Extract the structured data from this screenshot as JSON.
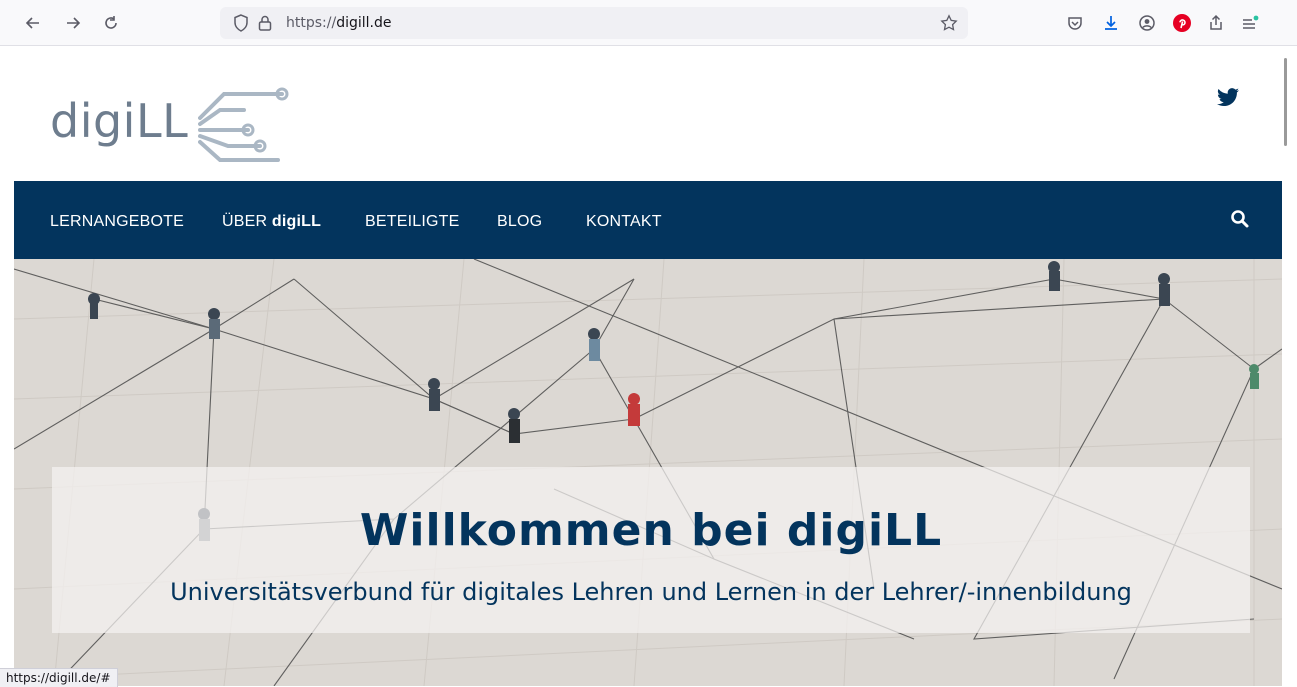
{
  "browser": {
    "url_scheme": "https://",
    "url_host": "digill.de",
    "status_url": "https://digill.de/#",
    "icons": [
      "back-icon",
      "forward-icon",
      "reload-icon",
      "shield-icon",
      "lock-icon",
      "star-icon",
      "pocket-icon",
      "download-icon",
      "account-icon",
      "pinterest-icon",
      "share-icon",
      "menu-icon"
    ]
  },
  "site": {
    "logo_text": "digiLL",
    "nav": {
      "items": [
        {
          "label": "LERNANGEBOTE"
        },
        {
          "prefix": "ÜBER ",
          "bold": "digiLL"
        },
        {
          "label": "BETEILIGTE"
        },
        {
          "label": "BLOG"
        },
        {
          "label": "KONTAKT"
        }
      ]
    },
    "hero": {
      "title": "Willkommen bei digiLL",
      "subtitle": "Universitätsverbund für digitales Lehren und Lernen in der Lehrer/-innenbildung"
    }
  },
  "colors": {
    "brand_navy": "#03345d",
    "logo_gray": "#6e7d8e",
    "pinterest_red": "#e60023",
    "download_blue": "#0061e0"
  }
}
